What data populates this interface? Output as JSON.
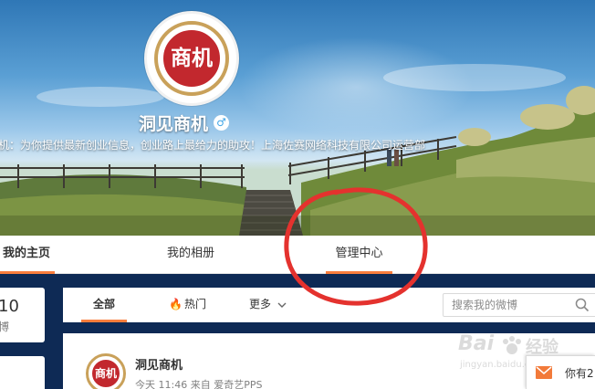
{
  "profile": {
    "avatar_text": "商机",
    "nickname": "洞见商机",
    "gender_icon": "male-icon",
    "gender_symbol": "♂",
    "intro": "机：为你提供最新创业信息，创业路上最给力的助攻！上海佐赛网络科技有限公司运营部"
  },
  "tabs": [
    {
      "label": "我的主页"
    },
    {
      "label": "我的相册"
    },
    {
      "label": "管理中心"
    }
  ],
  "stats": {
    "count": "10",
    "label": "博"
  },
  "feed": {
    "tabs": [
      {
        "label": "全部"
      },
      {
        "label": "热门",
        "icon": "fire-icon"
      },
      {
        "label": "更多",
        "icon": "chevron-down-icon"
      }
    ],
    "search_placeholder": "搜索我的微博"
  },
  "post": {
    "author": "洞见商机",
    "avatar_text": "商机",
    "meta": "今天 11:46 来自 爱奇艺PPS"
  },
  "message_popup": {
    "text": "你有2"
  },
  "watermark": {
    "brand": "Bai",
    "brand_tail": "经验",
    "url": "jingyan.baidu.com"
  },
  "colors": {
    "accent": "#fa7d3c",
    "annotation": "#e4322e",
    "page_bg": "#0e2a55"
  }
}
